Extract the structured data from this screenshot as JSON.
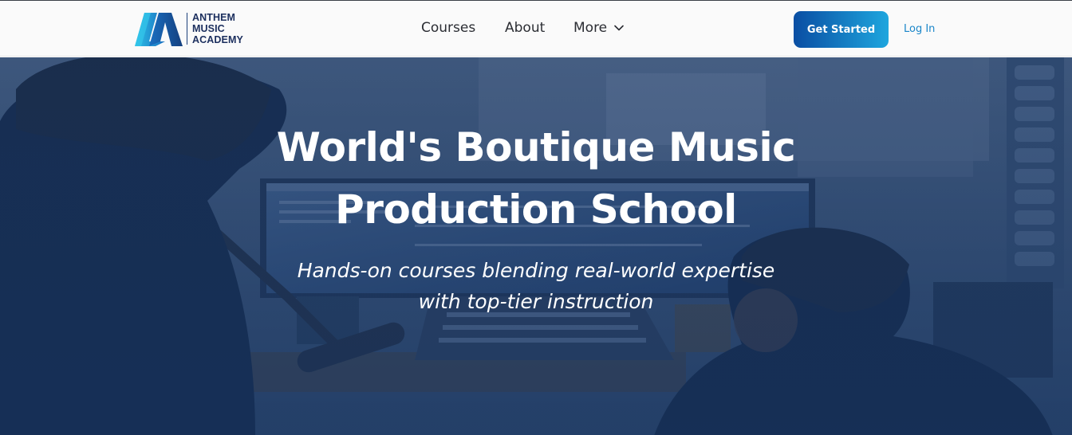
{
  "brand": {
    "line1": "ANTHEM",
    "line2": "MUSIC",
    "line3": "ACADEMY",
    "colors": {
      "navy": "#1c2f5e",
      "cyan": "#2cb5e3",
      "blue": "#0a4ea3"
    }
  },
  "nav": {
    "courses": "Courses",
    "about": "About",
    "more": "More"
  },
  "actions": {
    "get_started": "Get Started",
    "login": "Log In"
  },
  "hero": {
    "title_line1": "World's Boutique Music",
    "title_line2": "Production School",
    "subtitle_line1": "Hands-on courses blending real-world expertise",
    "subtitle_line2": "with top-tier instruction",
    "overlay_color": "#1c3a66"
  }
}
